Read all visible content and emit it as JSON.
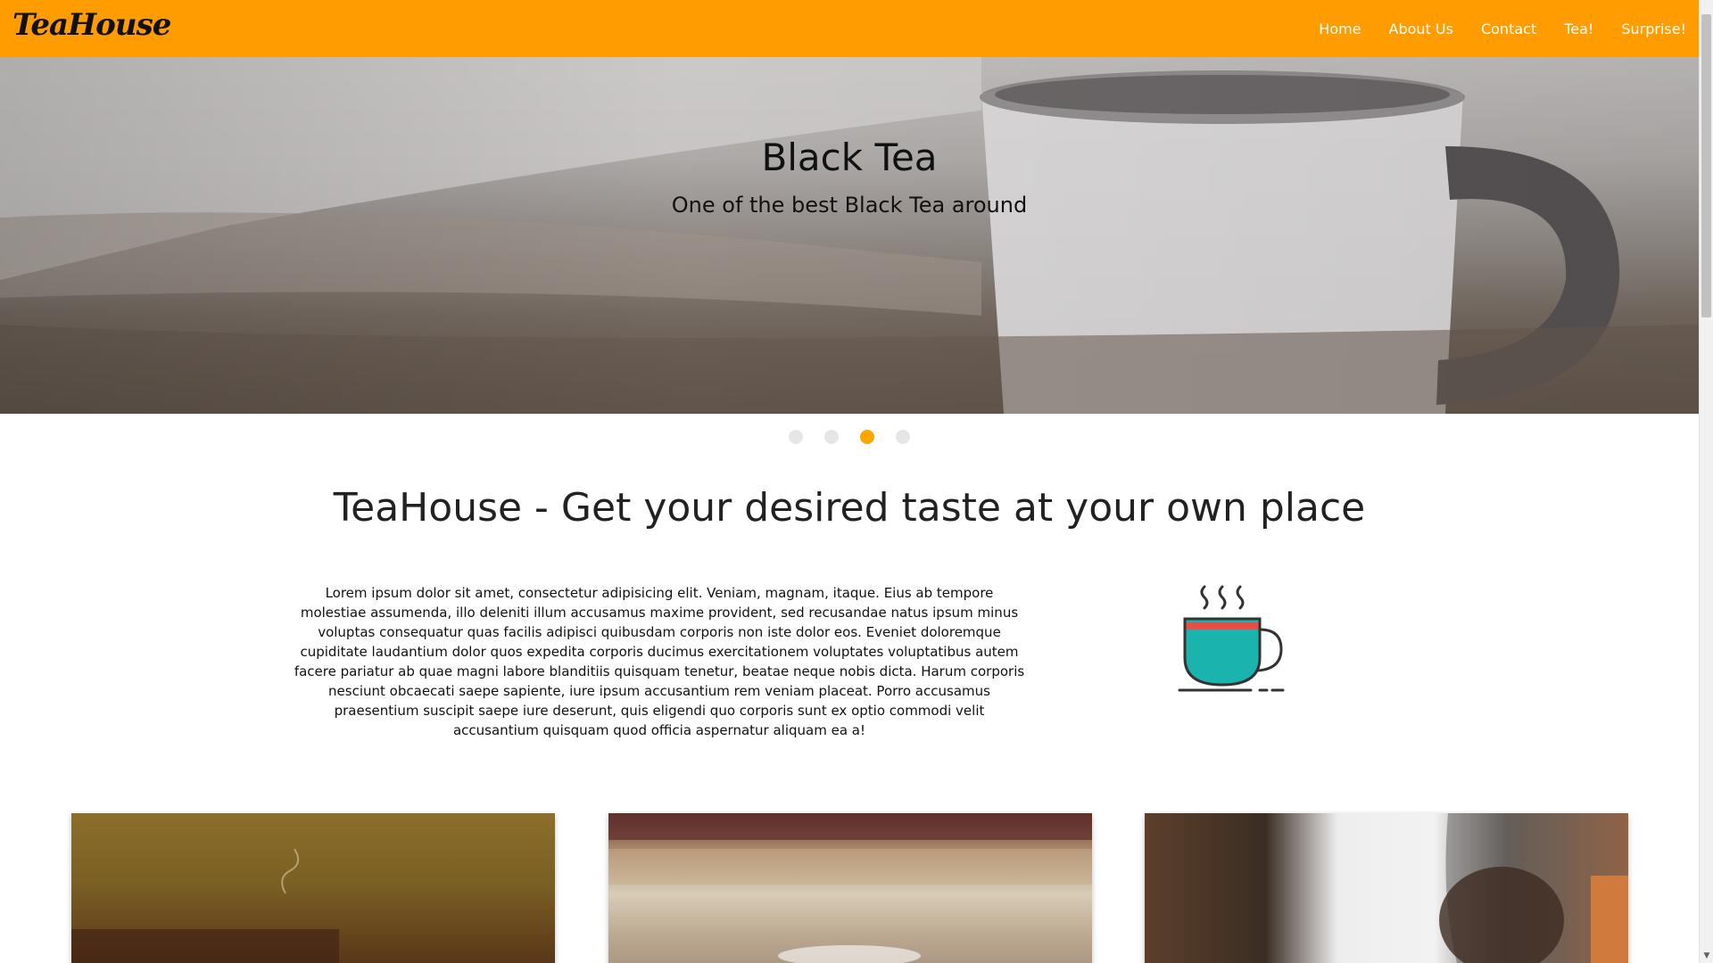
{
  "brand": {
    "name": "TeaHouse"
  },
  "nav": {
    "items": [
      "Home",
      "About Us",
      "Contact",
      "Tea!",
      "Surprise!"
    ]
  },
  "hero": {
    "title": "Black Tea",
    "subtitle": "One of the best Black Tea around"
  },
  "carousel": {
    "slide_count": 4,
    "active_index": 2
  },
  "main": {
    "headline": "TeaHouse - Get your desired taste at your own place",
    "intro": "Lorem ipsum dolor sit amet, consectetur adipisicing elit. Veniam, magnam, itaque. Eius ab tempore molestiae assumenda, illo deleniti illum accusamus maxime provident, sed recusandae natus ipsum minus voluptas consequatur quas facilis adipisci quibusdam corporis non iste dolor eos. Eveniet doloremque cupiditate laudantium dolor quos expedita corporis ducimus exercitationem voluptates voluptatibus autem facere pariatur ab quae magni labore blanditiis quisquam tenetur, beatae neque nobis dicta. Harum corporis nesciunt obcaecati saepe sapiente, iure ipsum accusantium rem veniam placeat. Porro accusamus praesentium suscipit saepe iure deserunt, quis eligendi quo corporis sunt ex optio commodi velit accusantium quisquam quod officia aspernatur aliquam ea a!",
    "intro_icon": "teacup-icon"
  },
  "cards": [
    {
      "image": "tea-cup-steam-photo"
    },
    {
      "image": "glass-cafe-photo"
    },
    {
      "image": "hands-tea-photo"
    }
  ],
  "colors": {
    "navbar": "#ff9d00",
    "active_dot": "#ffa500",
    "inactive_dot": "#e6e6e6",
    "cup_body": "#1bb3ad",
    "cup_band": "#e94d46"
  }
}
